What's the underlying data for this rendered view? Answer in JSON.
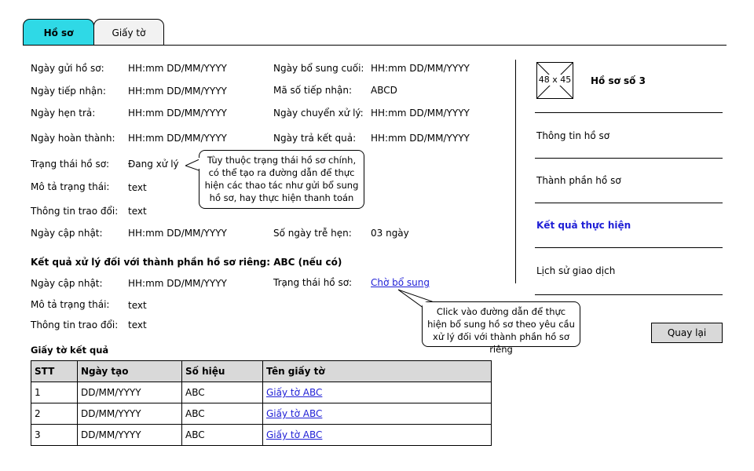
{
  "tabs": [
    {
      "label": "Hồ sơ",
      "active": true
    },
    {
      "label": "Giấy tờ",
      "active": false
    }
  ],
  "info": {
    "left": [
      {
        "label": "Ngày gửi hồ sơ:",
        "value": "HH:mm DD/MM/YYYY"
      },
      {
        "label": "Ngày tiếp nhận:",
        "value": "HH:mm DD/MM/YYYY"
      },
      {
        "label": "Ngày hẹn trả:",
        "value": "HH:mm DD/MM/YYYY"
      },
      {
        "label": "Ngày hoàn thành:",
        "value": "HH:mm DD/MM/YYYY"
      },
      {
        "label": "Trạng thái hồ sơ:",
        "value": "Đang xử lý"
      },
      {
        "label": "Mô tả trạng thái:",
        "value": "text"
      },
      {
        "label": "Thông tin trao đổi:",
        "value": "text"
      },
      {
        "label": "Ngày cập nhật:",
        "value": "HH:mm DD/MM/YYYY"
      }
    ],
    "right": [
      {
        "label": "Ngày bổ sung cuối:",
        "value": "HH:mm DD/MM/YYYY"
      },
      {
        "label": "Mã số tiếp nhận:",
        "value": "ABCD"
      },
      {
        "label": "Ngày chuyển xử lý:",
        "value": "HH:mm DD/MM/YYYY"
      },
      {
        "label": "Ngày trả kết quả:",
        "value": "HH:mm DD/MM/YYYY"
      },
      {
        "label": "Số ngày trễ hẹn:",
        "value": "03 ngày"
      }
    ]
  },
  "callout_status": "Tùy thuộc trạng thái hồ sơ chính, có thể tạo ra đường dẫn để thực hiện các thao tác như gửi bổ sung hồ sơ, hay thực hiện thanh toán",
  "component": {
    "heading": "Kết quả xử lý đối với thành phần hồ sơ riêng: ABC (nếu có)",
    "update_label": "Ngày cập nhật:",
    "update_value": "HH:mm DD/MM/YYYY",
    "status_label": "Trạng thái hồ sơ:",
    "status_link": "Chờ bổ sung",
    "desc_label": "Mô tả trạng thái:",
    "desc_value": "text",
    "exchange_label": "Thông tin trao đổi:",
    "exchange_value": "text"
  },
  "callout_link": "Click vào đường dẫn để thực hiện bổ sung hồ sơ theo yêu cầu xử lý đối với thành phần hồ sơ riêng",
  "results": {
    "heading": "Giấy tờ kết quả",
    "columns": [
      "STT",
      "Ngày tạo",
      "Số hiệu",
      "Tên giấy tờ"
    ],
    "rows": [
      [
        "1",
        "DD/MM/YYYY",
        "ABC",
        "Giấy tờ ABC"
      ],
      [
        "2",
        "DD/MM/YYYY",
        "ABC",
        "Giấy tờ ABC"
      ],
      [
        "3",
        "DD/MM/YYYY",
        "ABC",
        "Giấy tờ ABC"
      ]
    ]
  },
  "sidebar": {
    "image_placeholder": "48 x 45",
    "title": "Hồ sơ số 3",
    "items": [
      {
        "label": "Thông tin hồ sơ",
        "active": false
      },
      {
        "label": "Thành phần hồ sơ",
        "active": false
      },
      {
        "label": "Kết quả thực hiện",
        "active": true
      },
      {
        "label": "Lịch sử giao dịch",
        "active": false
      }
    ]
  },
  "back_button": "Quay lại",
  "colors": {
    "tab_active": "#2fd9e6",
    "link": "#1f1fd6",
    "button": "#d9d9d9"
  }
}
